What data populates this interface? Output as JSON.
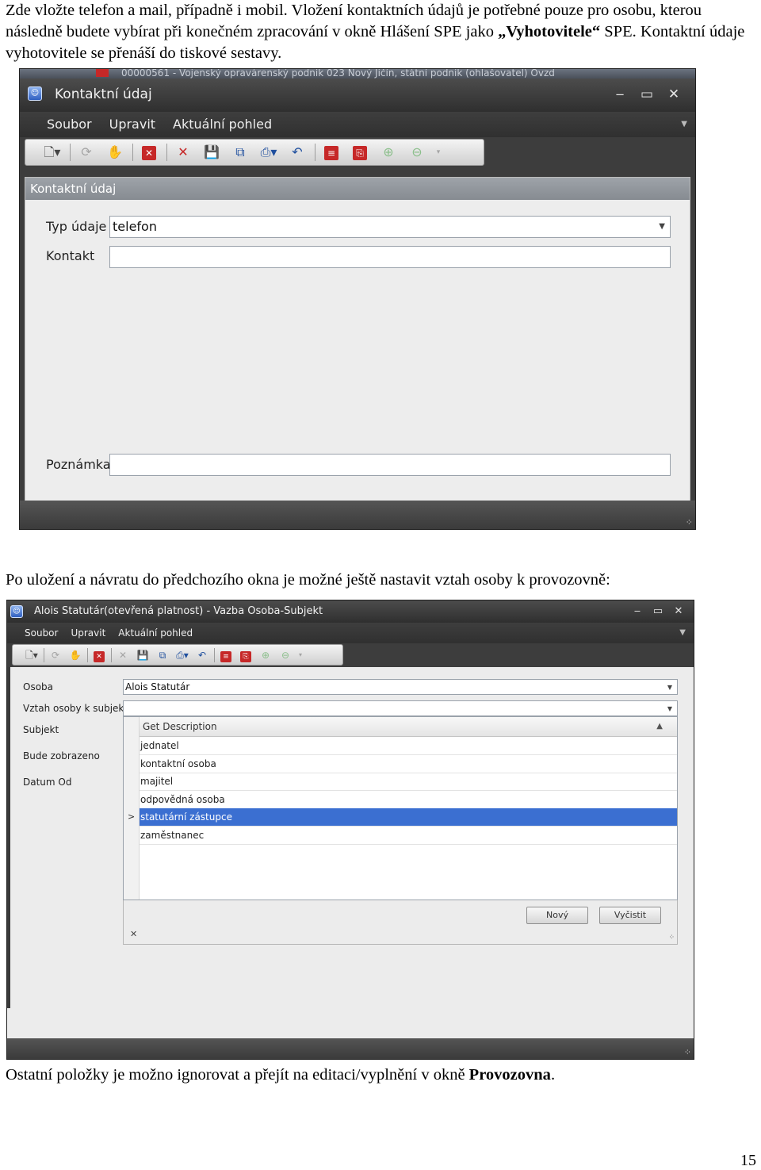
{
  "document": {
    "p1_pre": "Zde vložte telefon a mail, případně i mobil. Vložení kontaktních údajů je potřebné pouze pro osobu, kterou následně budete vybírat při konečném zpracování v okně Hlášení SPE jako ",
    "p1_bold": "„Vyhotovitele“",
    "p1_post": " SPE. Kontaktní údaje vyhotovitele se přenáší do tiskové sestavy.",
    "p2": "Po uložení a návratu do předchozího okna je možné ještě nastavit vztah osoby k provozovně:",
    "p3_pre": "Ostatní položky je možno ignorovat a přejít na editaci/vyplnění v okně ",
    "p3_bold": "Provozovna",
    "p3_post": ".",
    "page_number": "15"
  },
  "window1": {
    "behind_title": "00000561 - Vojenský opravárenský podnik 023 Nový Jičín, státní podnik (ohlašovatel) Ovzd",
    "title": "Kontaktní údaj",
    "menu": [
      "Soubor",
      "Upravit",
      "Aktuální pohled"
    ],
    "panel_title": "Kontaktní údaj",
    "labels": {
      "type": "Typ údaje",
      "contact": "Kontakt",
      "note": "Poznámka"
    },
    "values": {
      "type": "telefon",
      "contact": "",
      "note": ""
    }
  },
  "window2": {
    "title": "Alois Statutár(otevřená platnost) - Vazba Osoba-Subjekt",
    "menu": [
      "Soubor",
      "Upravit",
      "Aktuální pohled"
    ],
    "labels": {
      "osoba": "Osoba",
      "vztah": "Vztah osoby k subjektu",
      "subjekt": "Subjekt",
      "bude": "Bude zobrazeno",
      "datum": "Datum Od"
    },
    "values": {
      "osoba": "Alois Statutár",
      "vztah": ""
    },
    "list_header": "Get Description",
    "list_items": [
      "jednatel",
      "kontaktní osoba",
      "majitel",
      "odpovědná osoba",
      "statutární zástupce",
      "zaměstnanec"
    ],
    "selected_index": 4,
    "buttons": {
      "new": "Nový",
      "clear": "Vyčistit"
    }
  },
  "icons": {
    "new": "new-document-icon",
    "refresh": "refresh-icon",
    "hand": "hand-icon",
    "close-red": "close-box-icon",
    "delete": "delete-icon",
    "save": "save-icon",
    "save-all": "save-all-icon",
    "print": "print-icon",
    "undo": "undo-icon",
    "report": "report-icon",
    "export": "export-icon",
    "add": "add-icon",
    "remove": "remove-icon"
  },
  "colors": {
    "selection": "#3b6fd1",
    "window_dark": "#3d3d3d",
    "icon_red": "#c62828"
  }
}
